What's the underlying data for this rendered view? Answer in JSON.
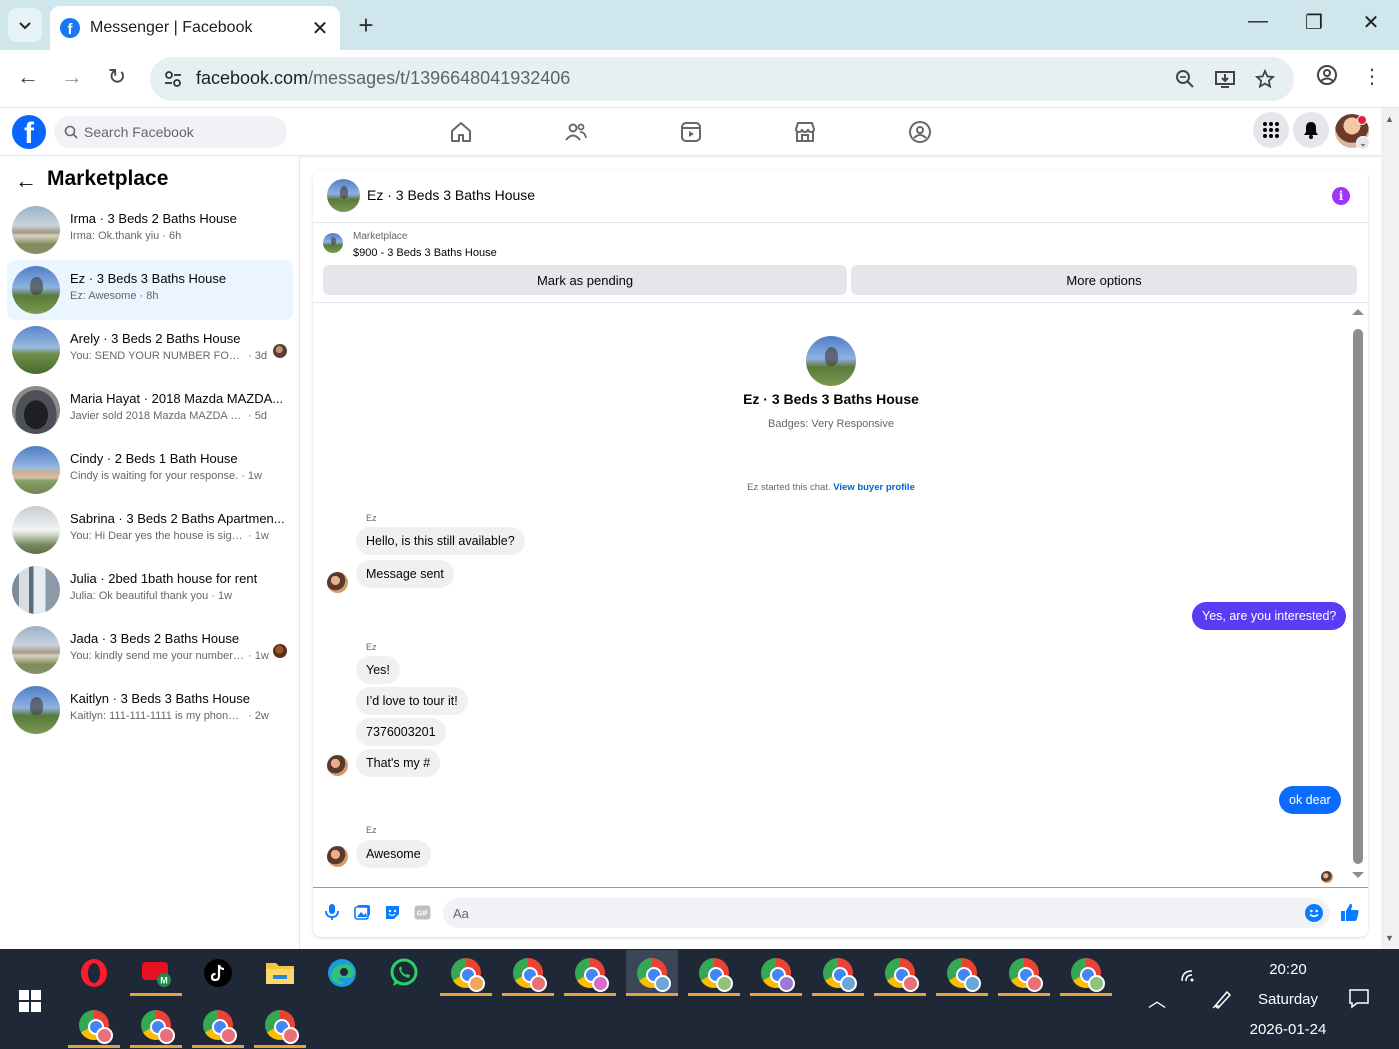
{
  "browser": {
    "tab_title": "Messenger | Facebook",
    "url_host": "facebook.com",
    "url_path": "/messages/t/1396648041932406"
  },
  "fb": {
    "search_placeholder": "Search Facebook"
  },
  "sidebar": {
    "title": "Marketplace",
    "conversations": [
      {
        "name": "Irma · 3 Beds 2 Baths House",
        "snippet": "Irma: Ok.thank yiu",
        "time": "6h",
        "active": false,
        "thumb": "house-a"
      },
      {
        "name": "Ez · 3 Beds 3 Baths House",
        "snippet": "Ez: Awesome",
        "time": "8h",
        "active": true,
        "thumb": "tree"
      },
      {
        "name": "Arely · 3 Beds 2 Baths House",
        "snippet": "You: SEND YOUR NUMBER FOR M...",
        "time": "3d",
        "active": false,
        "thumb": "lot",
        "read": true
      },
      {
        "name": "Maria Hayat · 2018 Mazda MAZDA...",
        "snippet": "Javier sold 2018 Mazda MAZDA MAZ...",
        "time": "5d",
        "active": false,
        "thumb": "car"
      },
      {
        "name": "Cindy · 2 Beds 1 Bath House",
        "snippet": "Cindy is waiting for your response.",
        "time": "1w",
        "active": false,
        "thumb": "house-b"
      },
      {
        "name": "Sabrina · 3 Beds 2 Baths Apartmen...",
        "snippet": "You: Hi Dear yes the house is sight av...",
        "time": "1w",
        "active": false,
        "thumb": "house-c"
      },
      {
        "name": "Julia · 2bed 1bath house for rent",
        "snippet": "Julia: Ok beautiful thank you",
        "time": "1w",
        "active": false,
        "thumb": "porch"
      },
      {
        "name": "Jada · 3 Beds 2 Baths House",
        "snippet": "You: kindly send me your number ...",
        "time": "1w",
        "active": false,
        "thumb": "house-a",
        "read": true
      },
      {
        "name": "Kaitlyn · 3 Beds 3 Baths House",
        "snippet": "Kaitlyn: 111-111-1111 is my phone n...",
        "time": "2w",
        "active": false,
        "thumb": "tree"
      }
    ]
  },
  "chat": {
    "title": "Ez · 3 Beds 3 Baths House",
    "listing_label": "Marketplace",
    "listing_price": "$900 - 3 Beds 3 Baths House",
    "mark_pending": "Mark as pending",
    "more_options": "More options",
    "intro_name": "Ez · 3 Beds 3 Baths House",
    "intro_badges": "Badges: Very Responsive",
    "started_text": "Ez started this chat. ",
    "started_link": "View buyer profile",
    "sender": "Ez",
    "messages": {
      "m1": "Hello, is this still available?",
      "m2": "Message sent",
      "m3": "Yes, are you interested?",
      "m4": "Yes!",
      "m5": "I’d love to tour it!",
      "m6": "7376003201",
      "m7": "That's my #",
      "m8": "ok dear",
      "m9": "Awesome"
    },
    "composer_placeholder": "Aa"
  },
  "taskbar": {
    "time": "20:20",
    "day": "Saturday",
    "date": "2026-01-24"
  },
  "colors": {
    "fb_blue": "#0866ff",
    "outgoing_bubble": "#5b3cf5",
    "outgoing_bubble_last": "#0a6cff",
    "info_icon": "#a033ff"
  }
}
